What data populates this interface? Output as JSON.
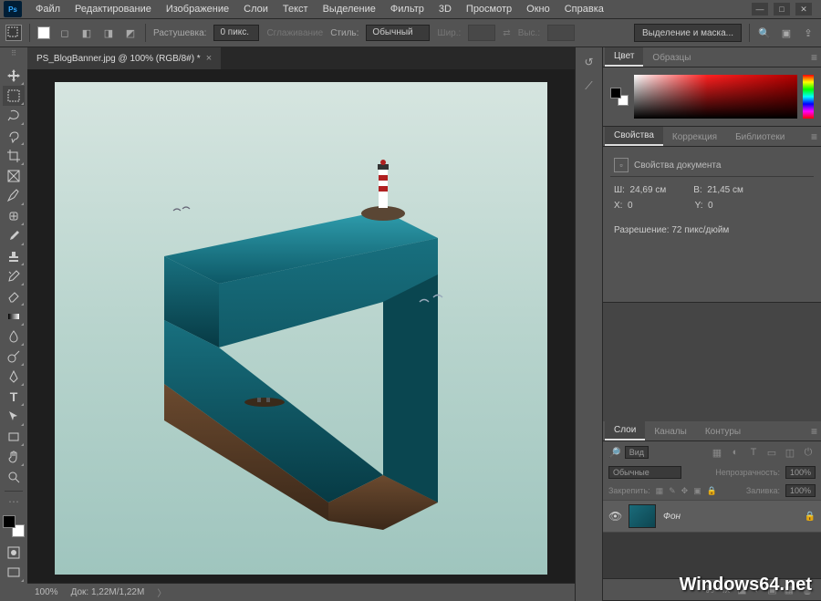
{
  "app": {
    "logo": "Ps"
  },
  "menu": [
    "Файл",
    "Редактирование",
    "Изображение",
    "Слои",
    "Текст",
    "Выделение",
    "Фильтр",
    "3D",
    "Просмотр",
    "Окно",
    "Справка"
  ],
  "window_controls": {
    "min": "—",
    "max": "□",
    "close": "✕"
  },
  "options": {
    "feather_label": "Растушевка:",
    "feather_value": "0 пикс.",
    "antialias": "Сглаживание",
    "style_label": "Стиль:",
    "style_value": "Обычный",
    "width_label": "Шир.:",
    "height_label": "Выс.:",
    "select_mask": "Выделение и маска..."
  },
  "document": {
    "tab_title": "PS_BlogBanner.jpg @ 100% (RGB/8#) *",
    "zoom": "100%",
    "doc_size": "Док: 1,22M/1,22M"
  },
  "panels": {
    "color": {
      "tabs": [
        "Цвет",
        "Образцы"
      ]
    },
    "properties": {
      "tabs": [
        "Свойства",
        "Коррекция",
        "Библиотеки"
      ],
      "title": "Свойства документа",
      "w_label": "Ш:",
      "w_val": "24,69 см",
      "h_label": "В:",
      "h_val": "21,45 см",
      "x_label": "X:",
      "x_val": "0",
      "y_label": "Y:",
      "y_val": "0",
      "res_label": "Разрешение:",
      "res_val": "72 пикс/дюйм"
    },
    "layers": {
      "tabs": [
        "Слои",
        "Каналы",
        "Контуры"
      ],
      "kind_label": "Вид",
      "blend": "Обычные",
      "opacity_label": "Непрозрачность:",
      "opacity_val": "100%",
      "lock_label": "Закрепить:",
      "fill_label": "Заливка:",
      "fill_val": "100%",
      "layer_name": "Фон"
    }
  },
  "watermark": "Windows64.net"
}
